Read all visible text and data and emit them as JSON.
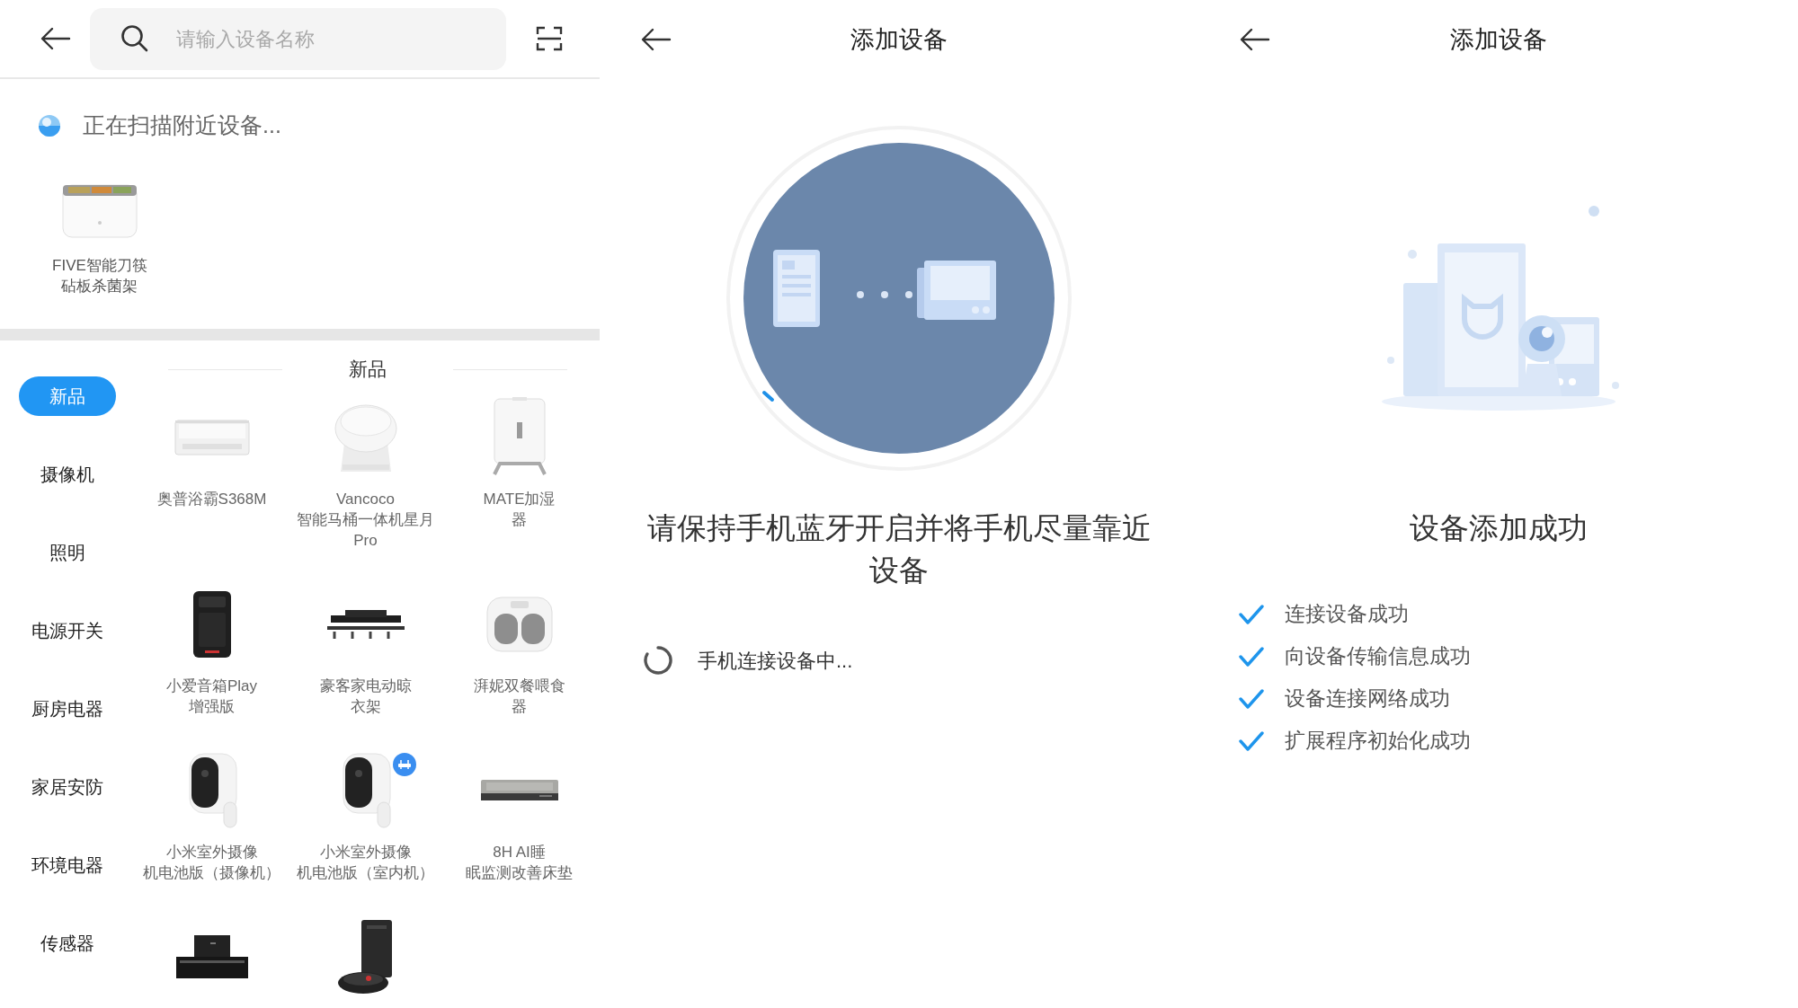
{
  "search_screen": {
    "search": {
      "placeholder": "请输入设备名称"
    },
    "scan_status": "正在扫描附近设备...",
    "nearby_devices": [
      {
        "lines": [
          "FIVE智能刀筷",
          "砧板杀菌架"
        ]
      }
    ],
    "categories": [
      {
        "label": "新品",
        "selected": true
      },
      {
        "label": "摄像机",
        "selected": false
      },
      {
        "label": "照明",
        "selected": false
      },
      {
        "label": "电源开关",
        "selected": false
      },
      {
        "label": "厨房电器",
        "selected": false
      },
      {
        "label": "家居安防",
        "selected": false
      },
      {
        "label": "环境电器",
        "selected": false
      },
      {
        "label": "传感器",
        "selected": false
      }
    ],
    "section_title": "新品",
    "products": [
      {
        "lines": [
          "奥普浴霸S368M"
        ],
        "has_badge": false
      },
      {
        "lines": [
          "Vancoco",
          "智能马桶一体机星月",
          "Pro"
        ],
        "has_badge": false
      },
      {
        "lines": [
          "MATE加湿",
          "器"
        ],
        "has_badge": false
      },
      {
        "lines": [
          "小爱音箱Play",
          "增强版"
        ],
        "has_badge": false
      },
      {
        "lines": [
          "豪客家电动晾",
          "衣架"
        ],
        "has_badge": false
      },
      {
        "lines": [
          "湃妮双餐喂食",
          "器"
        ],
        "has_badge": false
      },
      {
        "lines": [
          "小米室外摄像",
          "机电池版（摄像机）"
        ],
        "has_badge": false
      },
      {
        "lines": [
          "小米室外摄像",
          "机电池版（室内机）"
        ],
        "has_badge": true
      },
      {
        "lines": [
          "8H AI睡",
          "眠监测改善床垫"
        ],
        "has_badge": false
      },
      {
        "has_badge": false
      },
      {
        "has_badge": false
      }
    ]
  },
  "pairing_screen": {
    "title": "添加设备",
    "instruction": "请保持手机蓝牙开启并将手机尽量靠近设备",
    "status": "手机连接设备中..."
  },
  "success_screen": {
    "title": "添加设备",
    "result": "设备添加成功",
    "steps": [
      {
        "label": "连接设备成功",
        "done": true
      },
      {
        "label": "向设备传输信息成功",
        "done": true
      },
      {
        "label": "设备连接网络成功",
        "done": true
      },
      {
        "label": "扩展程序初始化成功",
        "done": true
      }
    ]
  }
}
